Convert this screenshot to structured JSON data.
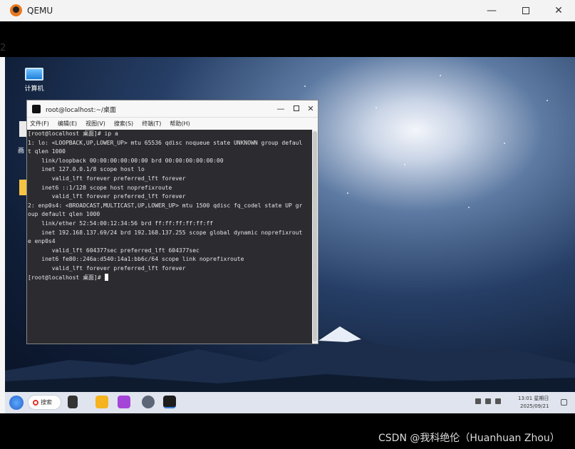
{
  "qemu": {
    "title": "QEMU",
    "minimize": "—",
    "close": "✕",
    "left_edge_glyph": "2"
  },
  "desktop": {
    "icons": [
      {
        "label": "计算机",
        "icon": "computer-icon"
      }
    ],
    "partial_text": "画"
  },
  "terminal": {
    "title": "root@localhost:~/桌面",
    "minimize": "—",
    "close": "✕",
    "menu": [
      "文件(F)",
      "编辑(E)",
      "视图(V)",
      "搜索(S)",
      "终端(T)",
      "帮助(H)"
    ],
    "lines": [
      "[root@localhost 桌面]# ip a",
      "1: lo: <LOOPBACK,UP,LOWER_UP> mtu 65536 qdisc noqueue state UNKNOWN group defaul",
      "t qlen 1000",
      "    link/loopback 00:00:00:00:00:00 brd 00:00:00:00:00:00",
      "    inet 127.0.0.1/8 scope host lo",
      "       valid_lft forever preferred_lft forever",
      "    inet6 ::1/128 scope host noprefixroute",
      "       valid_lft forever preferred_lft forever",
      "2: enp0s4: <BROADCAST,MULTICAST,UP,LOWER_UP> mtu 1500 qdisc fq_codel state UP gr",
      "oup default qlen 1000",
      "    link/ether 52:54:00:12:34:56 brd ff:ff:ff:ff:ff:ff",
      "    inet 192.168.137.69/24 brd 192.168.137.255 scope global dynamic noprefixrout",
      "e enp0s4",
      "       valid_lft 604377sec preferred_lft 604377sec",
      "    inet6 fe80::246a:d540:14a1:bb6c/64 scope link noprefixroute",
      "       valid_lft forever preferred_lft forever"
    ],
    "prompt": "[root@localhost 桌面]# "
  },
  "taskbar": {
    "search_label": "搜索",
    "clock_time": "13:01 星期日",
    "clock_date": "2025/09/21"
  },
  "watermark": "CSDN @我科绝伦（Huanhuan Zhou）"
}
